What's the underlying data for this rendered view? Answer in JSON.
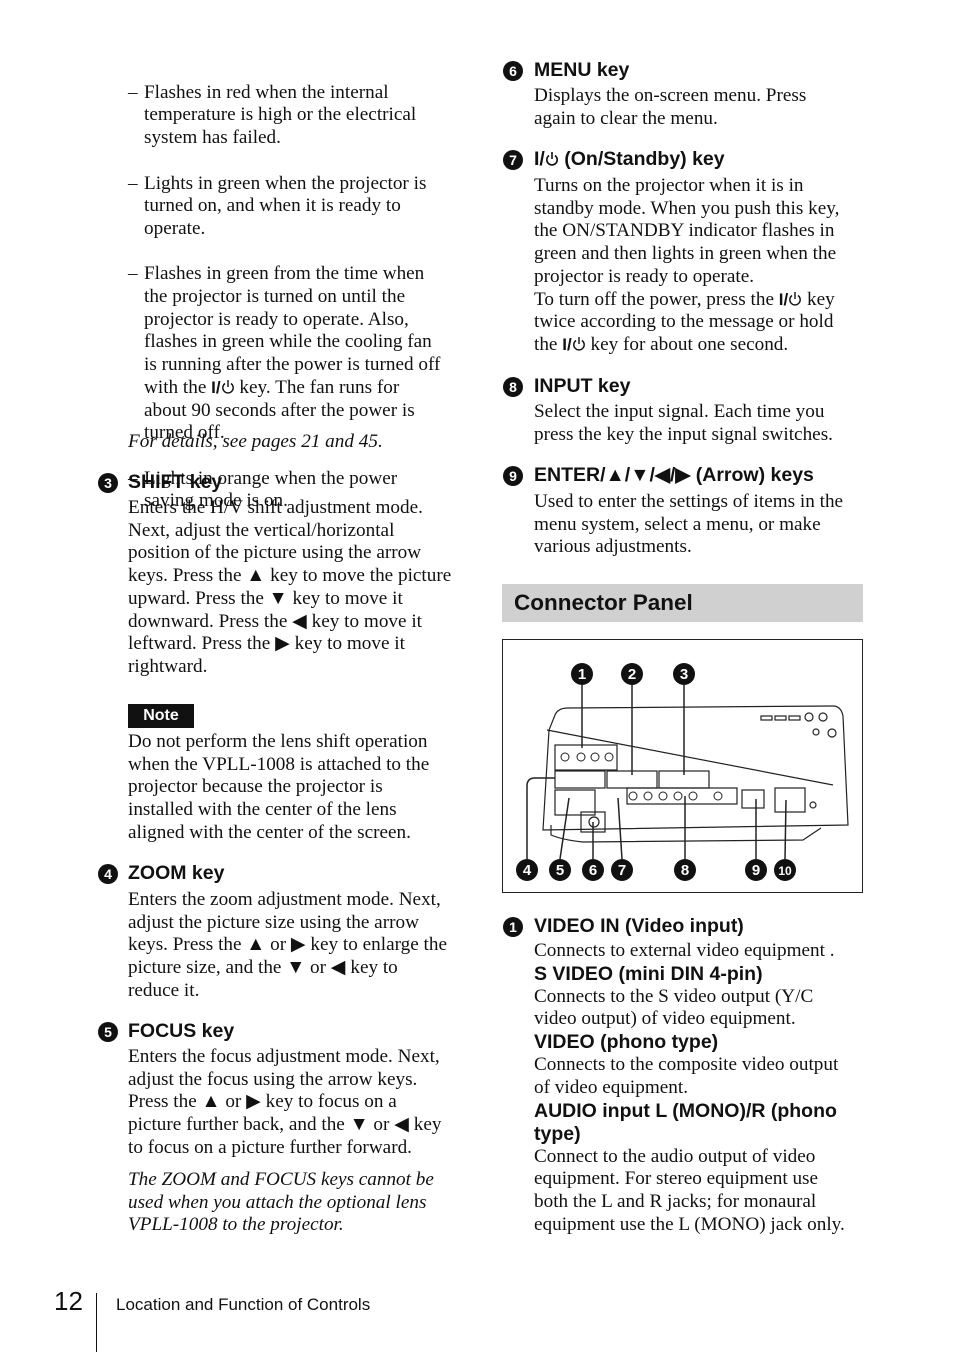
{
  "left": {
    "bullets": [
      "Flashes in red when the internal\ntemperature is high or the electrical\nsystem has failed.",
      "Lights in green when the projector is\nturned on, and when it is ready to\noperate.",
      "Flashes in green from the time when\nthe projector is turned on until the\nprojector is ready to operate. Also,\nflashes in green while the cooling fan\nis running after the power is turned off",
      "Lights in orange when the power\nsaving mode is on."
    ],
    "bullet3_tail_a": "with the ",
    "bullet3_tail_key": "I/",
    "bullet3_tail_b": " key. The fan runs for\nabout 90 seconds after the power is\nturned off.",
    "dash": "–",
    "details": "For details, see pages 21 and 45.",
    "shift": {
      "num": "3",
      "title": "SHIFT key",
      "body": "Enters the H/V shift adjustment mode.\nNext, adjust the vertical/horizontal\nposition of the picture using the arrow\nkeys. Press the ▲ key to move the picture\nupward. Press the ▼ key to move it\ndownward. Press the ◀ key to move it\nleftward. Press the ▶ key to move it\nrightward."
    },
    "note_label": "Note",
    "note_body": "Do not perform the lens shift operation\nwhen the VPLL-1008 is attached to the\nprojector because the projector is\ninstalled with the center of the lens\naligned with the center of the screen.",
    "zoom": {
      "num": "4",
      "title": "ZOOM key",
      "body": "Enters the zoom adjustment mode. Next,\nadjust the picture size using the arrow\nkeys. Press the ▲ or ▶ key to enlarge the\npicture size, and the ▼ or ◀ key to\nreduce it."
    },
    "focus": {
      "num": "5",
      "title": "FOCUS key",
      "body": "Enters the focus adjustment mode. Next,\nadjust the focus using the arrow keys.\nPress the ▲ or ▶ key to focus on a\npicture further back, and the ▼ or ◀ key\nto focus on a picture further forward."
    },
    "focus_note": "The ZOOM and FOCUS keys cannot be\nused when you attach the optional lens\nVPLL-1008 to the projector."
  },
  "right": {
    "menu": {
      "num": "6",
      "title": "MENU key",
      "body": "Displays the on-screen menu. Press\nagain to clear the menu."
    },
    "standby": {
      "num": "7",
      "title_key": "I/",
      "title": " (On/Standby) key",
      "body1": "Turns on the projector when it is in\nstandby mode. When you push this key,\nthe ON/STANDBY indicator flashes in\ngreen and then lights in green when the\nprojector is ready to operate.",
      "body2a": "To turn off the power, press the ",
      "key": "I/",
      "body2b": " key\ntwice according to the message or hold\nthe ",
      "body2c": " key for about one second."
    },
    "input": {
      "num": "8",
      "title": "INPUT key",
      "body": "Select the input signal. Each time you\npress the key the input signal switches."
    },
    "enter": {
      "num": "9",
      "title": "ENTER/▲/▼/◀/▶ (Arrow) keys",
      "body": "Used to enter the settings of items in the\nmenu system, select a menu, or make\nvarious adjustments."
    },
    "section_title": "Connector Panel",
    "diagram_callouts": [
      "1",
      "2",
      "3",
      "4",
      "5",
      "6",
      "7",
      "8",
      "9",
      "10"
    ],
    "video": {
      "num": "1",
      "title": "VIDEO IN (Video input)",
      "p1": "Connects to external video equipment .",
      "s1": "S VIDEO (mini DIN 4-pin)",
      "p2": " Connects to the S video output (Y/C\nvideo output) of video equipment.",
      "s2": "VIDEO (phono type)",
      "p3": "Connects to the composite video output\nof video equipment.",
      "s3": "AUDIO input L (MONO)/R (phono\ntype)",
      "p4": "Connect to the audio output of video\nequipment. For stereo equipment use\nboth the L and R jacks; for monaural\nequipment use the L (MONO) jack only."
    }
  },
  "footer": {
    "page_number": "12",
    "section": "Location and Function of Controls"
  }
}
